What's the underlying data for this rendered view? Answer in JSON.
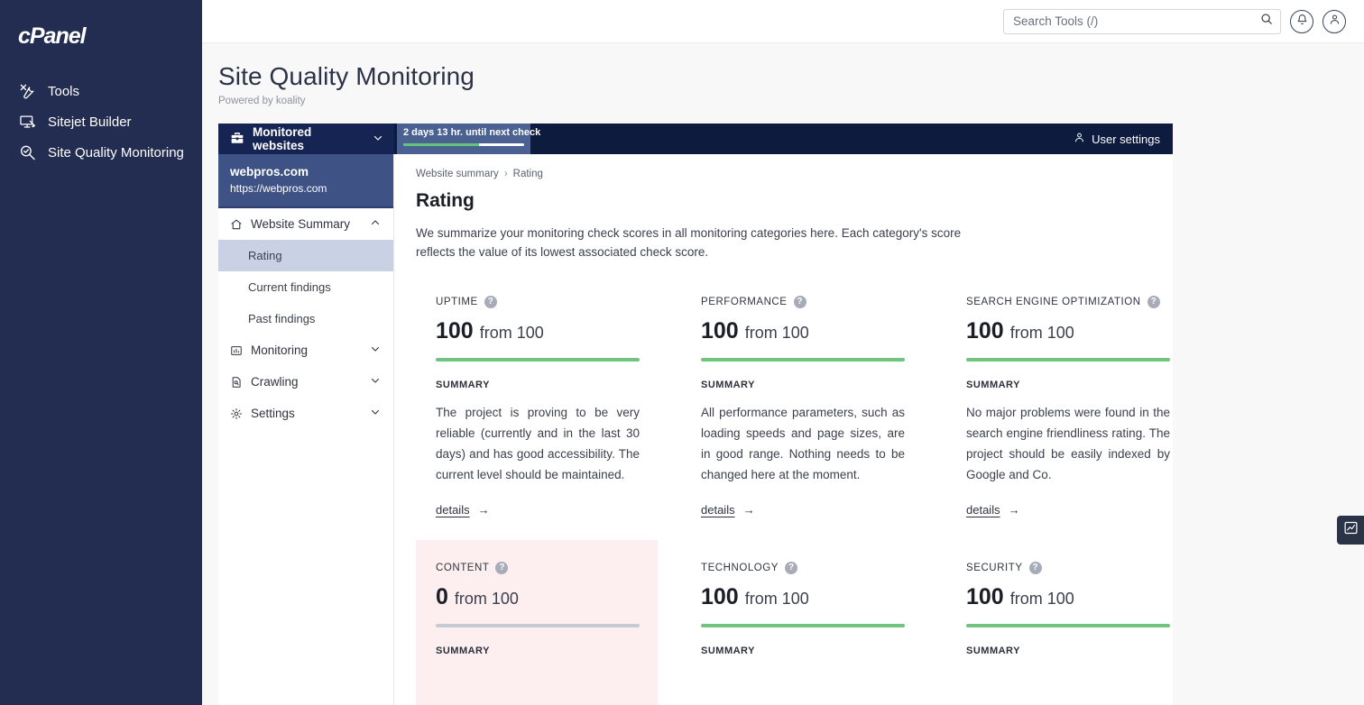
{
  "brand": {
    "logo_text": "cPanel"
  },
  "rail": {
    "items": [
      {
        "label": "Tools",
        "icon": "tools-icon"
      },
      {
        "label": "Sitejet Builder",
        "icon": "monitor-pencil-icon"
      },
      {
        "label": "Site Quality Monitoring",
        "icon": "magnifier-check-icon"
      }
    ]
  },
  "topbar": {
    "search_placeholder": "Search Tools (/)",
    "search_value": "",
    "search_icon": "search-icon",
    "notifications_icon": "bell-icon",
    "account_icon": "user-icon"
  },
  "page": {
    "title": "Site Quality Monitoring",
    "subtitle": "Powered by koality"
  },
  "koality_topbar": {
    "selector_label": "Monitored websites",
    "selector_icon": "toolbox-icon",
    "selector_caret": "chevron-down-icon",
    "tooltip_text": "2 days 13 hr. until next check",
    "tooltip_progress_percent": 63,
    "user_settings_label": "User settings",
    "user_settings_icon": "user-icon"
  },
  "site": {
    "name": "webpros.com",
    "url": "https://webpros.com"
  },
  "sidebar": {
    "groups": [
      {
        "label": "Website Summary",
        "icon": "home-icon",
        "caret": "chevron-up-icon",
        "expanded": true
      },
      {
        "label": "Monitoring",
        "icon": "chart-icon",
        "caret": "chevron-down-icon",
        "expanded": false
      },
      {
        "label": "Crawling",
        "icon": "document-search-icon",
        "caret": "chevron-down-icon",
        "expanded": false
      },
      {
        "label": "Settings",
        "icon": "gear-icon",
        "caret": "chevron-down-icon",
        "expanded": false
      }
    ],
    "sub_items": [
      {
        "label": "Rating",
        "active": true
      },
      {
        "label": "Current findings",
        "active": false
      },
      {
        "label": "Past findings",
        "active": false
      }
    ]
  },
  "main": {
    "breadcrumb": {
      "parent": "Website summary",
      "separator": "›",
      "current": "Rating"
    },
    "heading": "Rating",
    "description": "We summarize your monitoring check scores in all monitoring categories here. Each category's score reflects the value of its lowest associated check score.",
    "summary_label": "SUMMARY",
    "details_label": "details",
    "details_arrow": "→",
    "score_suffix": "from 100",
    "help_glyph": "?",
    "colors": {
      "bar_good": "#6fc47f",
      "bar_empty": "#c7ccd4",
      "negative_card_bg": "#fdeef0"
    },
    "cards": [
      {
        "label": "UPTIME",
        "score": "100",
        "max": "100",
        "percent": 100,
        "negative": false,
        "summary": "The project is proving to be very reliable (currently and in the last 30 days) and has good accessibility. The current level should be maintained."
      },
      {
        "label": "PERFORMANCE",
        "score": "100",
        "max": "100",
        "percent": 100,
        "negative": false,
        "summary": "All performance parameters, such as loading speeds and page sizes, are in good range. Nothing needs to be changed here at the moment."
      },
      {
        "label": "SEARCH ENGINE OPTIMIZATION",
        "score": "100",
        "max": "100",
        "percent": 100,
        "negative": false,
        "summary": "No major problems were found in the search engine friendliness rating. The project should be easily indexed by Google and Co."
      },
      {
        "label": "CONTENT",
        "score": "0",
        "max": "100",
        "percent": 0,
        "negative": true,
        "summary": ""
      },
      {
        "label": "TECHNOLOGY",
        "score": "100",
        "max": "100",
        "percent": 100,
        "negative": false,
        "summary": ""
      },
      {
        "label": "SECURITY",
        "score": "100",
        "max": "100",
        "percent": 100,
        "negative": false,
        "summary": ""
      }
    ]
  },
  "widget": {
    "icon": "analytics-chart-icon"
  }
}
